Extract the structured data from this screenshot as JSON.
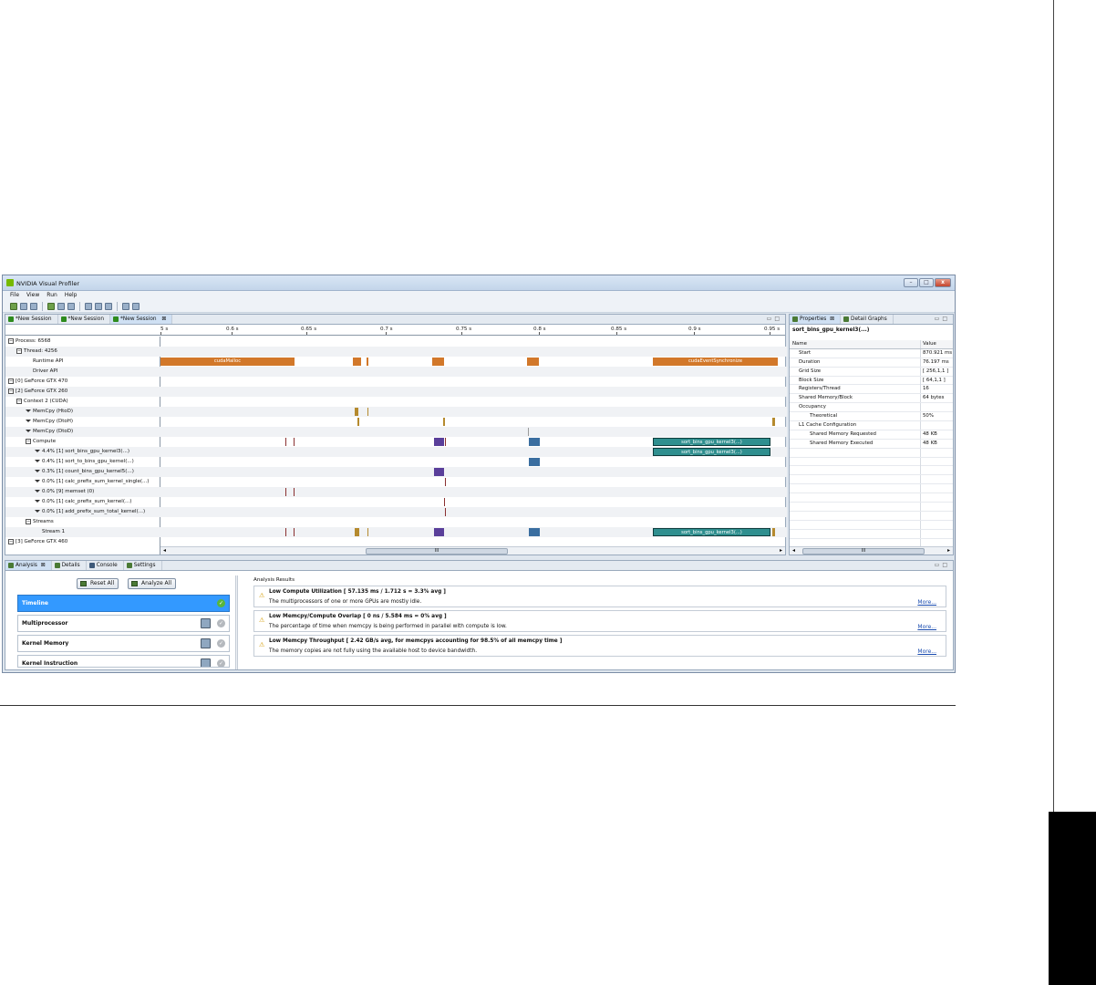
{
  "window": {
    "title": "NVIDIA Visual Profiler",
    "controls": [
      "–",
      "□",
      "x"
    ]
  },
  "menu": [
    "File",
    "View",
    "Run",
    "Help"
  ],
  "session_tabs": [
    {
      "label": "*New Session"
    },
    {
      "label": "*New Session"
    },
    {
      "label": "*New Session",
      "active": true,
      "close": "⊠"
    }
  ],
  "ruler_ticks": [
    "5 s",
    "0.6 s",
    "0.65 s",
    "0.7 s",
    "0.75 s",
    "0.8 s",
    "0.85 s",
    "0.9 s",
    "0.95 s"
  ],
  "tree": [
    "Process: 6568",
    "Thread: 4256",
    "Runtime API",
    "Driver API",
    "[0] GeForce GTX 470",
    "[2] GeForce GTX 260",
    "Context 2 (CUDA)",
    "MemCpy (HtoD)",
    "MemCpy (DtoH)",
    "MemCpy (DtoD)",
    "Compute",
    "4.4% [1] sort_bins_gpu_kernel3(...)",
    "0.4% [1] sort_to_bins_gpu_kernel(...)",
    "0.3% [1] count_bins_gpu_kernel5(...)",
    "0.0% [1] calc_prefix_sum_kernel_single(...)",
    "0.0% [9] memset (0)",
    "0.0% [1] calc_prefix_sum_kernel(...)",
    "0.0% [1] add_prefix_sum_total_kernel(...)",
    "Streams",
    "Stream 1",
    "[3] GeForce GTX 460"
  ],
  "timeline_labels": {
    "cudaMalloc": "cudaMalloc",
    "sync": "cudaEventSynchronize",
    "kernel": "sort_bins_gpu_kernel3(...)"
  },
  "scroll": {
    "thumb": "III",
    "left": "◂",
    "right": "▸"
  },
  "properties": {
    "tabs": [
      "Properties",
      "Detail Graphs"
    ],
    "title": "sort_bins_gpu_kernel3(...)",
    "header": {
      "name": "Name",
      "value": "Value"
    },
    "rows": [
      {
        "name": "Start",
        "value": "870.921 ms"
      },
      {
        "name": "Duration",
        "value": "76.197 ms"
      },
      {
        "name": "Grid Size",
        "value": "[ 256,1,1 ]"
      },
      {
        "name": "Block Size",
        "value": "[ 64,1,1 ]"
      },
      {
        "name": "Registers/Thread",
        "value": "16"
      },
      {
        "name": "Shared Memory/Block",
        "value": "64 bytes"
      },
      {
        "name": "Occupancy",
        "value": ""
      },
      {
        "name": "Theoretical",
        "value": "50%"
      },
      {
        "name": "L1 Cache Configuration",
        "value": ""
      },
      {
        "name": "Shared Memory Requested",
        "value": "48 KB"
      },
      {
        "name": "Shared Memory Executed",
        "value": "48 KB"
      }
    ]
  },
  "bottom_tabs": [
    "Analysis",
    "Details",
    "Console",
    "Settings"
  ],
  "analysis": {
    "reset_all": "Reset All",
    "analyze_all": "Analyze All",
    "stages": [
      "Timeline",
      "Multiprocessor",
      "Kernel Memory",
      "Kernel Instruction"
    ],
    "results_title": "Analysis Results",
    "results": [
      {
        "heading": "Low Compute Utilization [ 57.135 ms / 1.712 s = 3.3% avg ]",
        "desc": "The multiprocessors of one or more GPUs are mostly idle.",
        "more": "More..."
      },
      {
        "heading": "Low Memcpy/Compute Overlap [ 0 ns / 5.584 ms = 0% avg ]",
        "desc": "The percentage of time when memcpy is being performed in parallel with compute is low.",
        "more": "More..."
      },
      {
        "heading": "Low Memcpy Throughput [ 2.42 GB/s avg, for memcpys accounting for 98.5% of all memcpy time ]",
        "desc": "The memory copies are not fully using the available host to device bandwidth.",
        "more": "More..."
      }
    ]
  },
  "colors": {
    "runtime": "#d2782a",
    "memcpy": "#b58a2e",
    "kernel_teal": "#2f8f8f",
    "kernel_purple": "#5a3f9a",
    "kernel_blue": "#3a6ea0",
    "selected": "#3399ff"
  }
}
